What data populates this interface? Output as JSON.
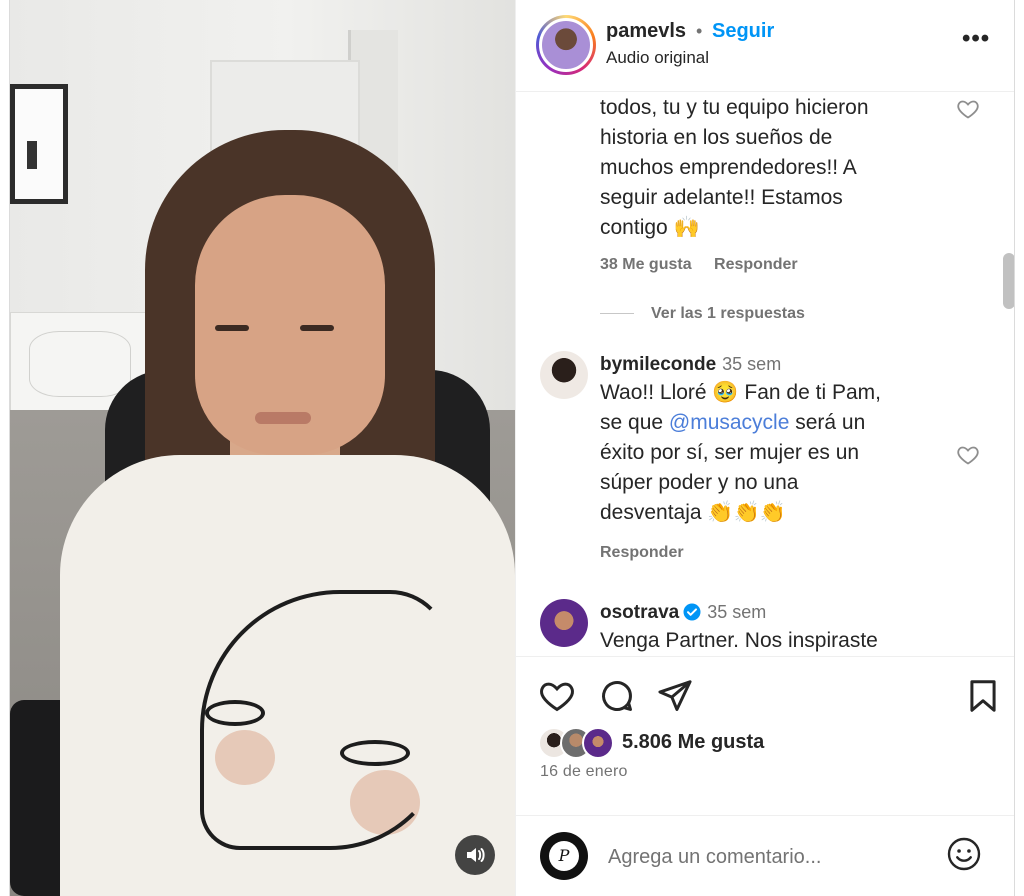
{
  "post": {
    "username": "pamevls",
    "separator": "•",
    "follow_label": "Seguir",
    "audio_label": "Audio original",
    "more_label": "•••"
  },
  "comments": [
    {
      "text_lines": [
        "todos, tu y tu equipo hicieron",
        "historia en los sueños de",
        "muchos emprendedores!! A",
        "seguir adelante!! Estamos",
        "contigo 🙌"
      ],
      "likes_label": "38 Me gusta",
      "reply_label": "Responder",
      "view_replies_label": "Ver las 1 respuestas"
    },
    {
      "username": "bymileconde",
      "time": "35 sem",
      "text_lines": [
        "Wao!! Lloré 🥹 Fan de ti Pam,",
        "se que @musacycle será un",
        "éxito por sí, ser mujer es un",
        "súper poder y no una",
        "desventaja 👏👏👏"
      ],
      "mention": "@musacycle",
      "reply_label": "Responder"
    },
    {
      "username": "osotrava",
      "time": "35 sem",
      "verified": true,
      "text_lines": [
        "Venga Partner. Nos inspiraste"
      ]
    }
  ],
  "actions": {
    "like_icon": "heart-icon",
    "comment_icon": "comment-icon",
    "share_icon": "share-icon",
    "save_icon": "bookmark-icon"
  },
  "likes_label": "5.806 Me gusta",
  "date_label": "16 de enero",
  "add_comment": {
    "placeholder": "Agrega un comentario...",
    "emoji_icon": "emoji-icon"
  },
  "colors": {
    "accent_blue": "#0095f6",
    "text_primary": "#262626",
    "text_secondary": "#737373",
    "mention": "#4c7ed9"
  }
}
